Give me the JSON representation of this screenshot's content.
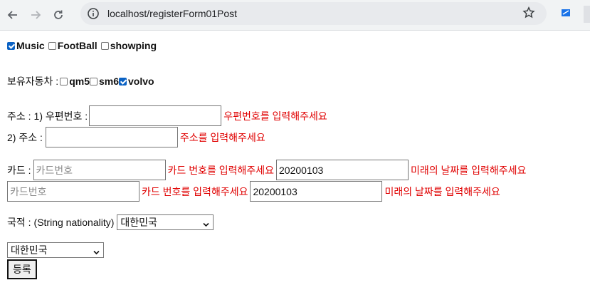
{
  "browser": {
    "url": "localhost/registerForm01Post"
  },
  "hobbies": [
    {
      "label": "Music",
      "checked": true
    },
    {
      "label": "FootBall",
      "checked": false
    },
    {
      "label": "showping",
      "checked": false
    }
  ],
  "cars": {
    "label": "보유자동차 :",
    "items": [
      {
        "label": "qm5",
        "checked": false
      },
      {
        "label": "sm6",
        "checked": false
      },
      {
        "label": "volvo",
        "checked": true
      }
    ]
  },
  "address": {
    "label": "주소 :",
    "zip_label": "1) 우편번호 :",
    "zip_value": "",
    "zip_error": "우편번호를 입력해주세요",
    "addr_label": "2) 주소 :",
    "addr_value": "",
    "addr_error": "주소를 입력해주세요"
  },
  "card": {
    "label": "카드 :",
    "rows": [
      {
        "number_placeholder": "카드번호",
        "number_error": "카드 번호를 입력해주세요",
        "date_value": "20200103",
        "date_error": "미래의 날짜를 입력해주세요"
      },
      {
        "number_placeholder": "카드번호",
        "number_error": "카드 번호를 입력해주세요",
        "date_value": "20200103",
        "date_error": "미래의 날짜를 입력해주세요"
      }
    ]
  },
  "nationality": {
    "label": "국적 :",
    "hint": "(String nationality)",
    "selected": "대한민국",
    "second_selected": "대한민국"
  },
  "submit_label": "등록",
  "colors": {
    "error": "#e00000",
    "checkbox": "#0b62c4",
    "toolbar": "#f1f3f4"
  }
}
